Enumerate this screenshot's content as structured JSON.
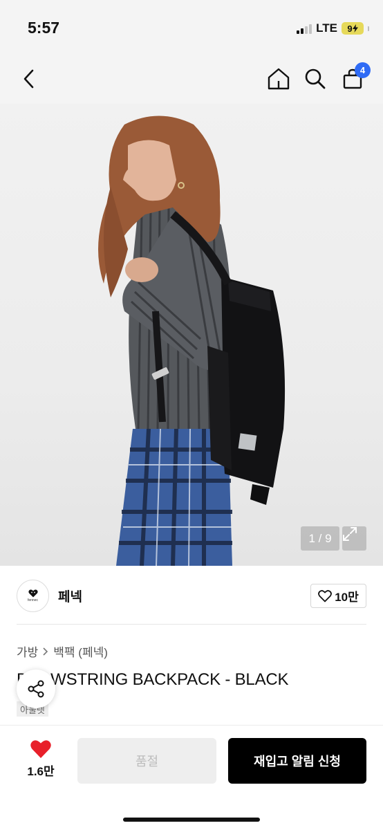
{
  "status_bar": {
    "time": "5:57",
    "network": "LTE",
    "battery": "9"
  },
  "nav": {
    "cart_count": "4"
  },
  "gallery": {
    "counter": "1 / 9"
  },
  "brand": {
    "name": "페넥",
    "logo_text": "fennec",
    "likes": "10만"
  },
  "breadcrumb": {
    "category": "가방",
    "subcategory": "백팩 (페넥)"
  },
  "product": {
    "title": "DRAWSTRING BACKPACK - BLACK",
    "sub_label": "아울렛"
  },
  "bottom_bar": {
    "like_count": "1.6만",
    "soldout_label": "품절",
    "restock_label": "재입고 알림 신청"
  },
  "colors": {
    "accent_badge": "#2f6bf5",
    "heart": "#e8202a",
    "primary_button": "#000000"
  }
}
